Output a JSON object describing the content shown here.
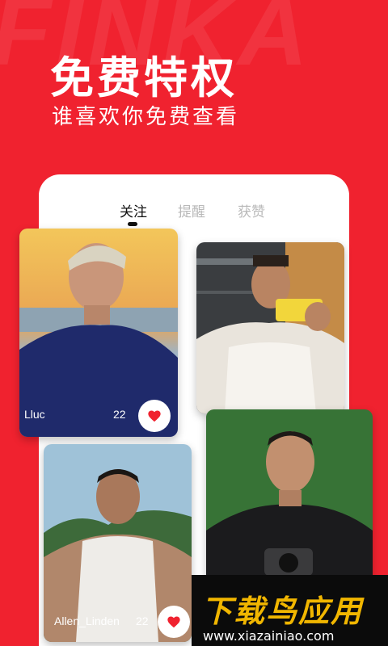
{
  "banner": {
    "background_letters": "FINKA",
    "title": "免费特权",
    "subtitle": "谁喜欢你免费查看"
  },
  "tabs": [
    {
      "label": "关注",
      "active": true
    },
    {
      "label": "提醒",
      "active": false
    },
    {
      "label": "获赞",
      "active": false
    }
  ],
  "cards": [
    {
      "name": "Lluc",
      "age": "22",
      "liked": true
    },
    {
      "name": "",
      "age": "",
      "liked": false
    },
    {
      "name": "",
      "age": "",
      "liked": false
    },
    {
      "name": "Allen_Linden",
      "age": "22",
      "liked": true
    }
  ],
  "watermark": {
    "title": "下载鸟应用",
    "url": "www.xiazainiao.com"
  },
  "colors": {
    "brand_red": "#f0222f",
    "like_heart": "#f0222f",
    "watermark_gold": "#f1b600"
  }
}
